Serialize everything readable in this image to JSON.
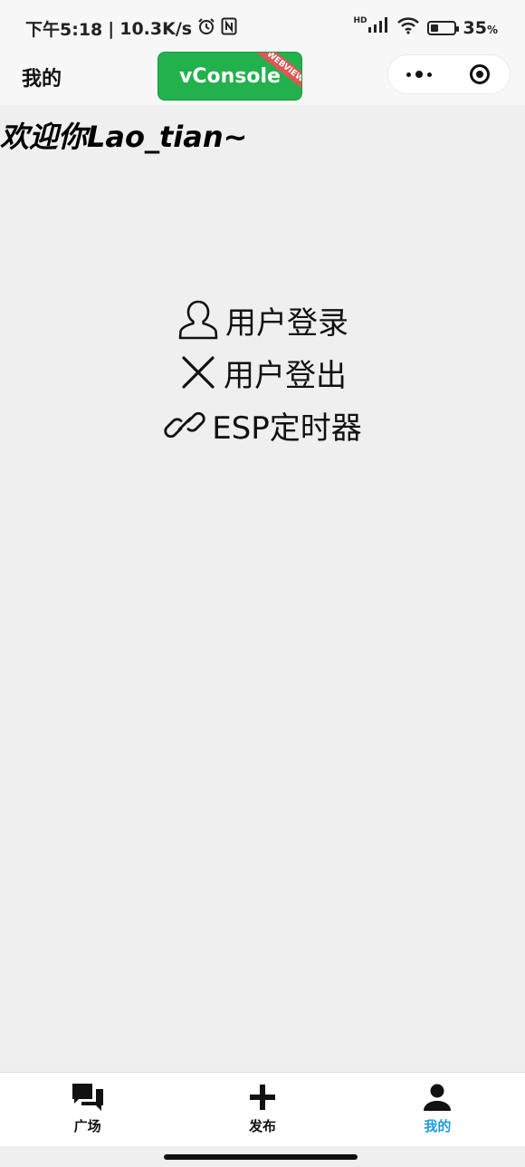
{
  "status_bar": {
    "time": "下午5:18",
    "network_speed": "10.3K/s",
    "signal_label": "HD",
    "battery_percent": "35",
    "battery_unit": "%",
    "battery_level": 0.35,
    "icons": [
      "alarm-icon",
      "nfc-icon",
      "signal-icon",
      "wifi-icon",
      "battery-icon"
    ]
  },
  "nav_bar": {
    "title": "我的",
    "vconsole_label": "vConsole",
    "vconsole_ribbon": "WEBVIEW",
    "vconsole_color": "#23b14d"
  },
  "main": {
    "welcome": "欢迎你Lao_tian~",
    "menu": [
      {
        "icon": "user-icon",
        "label": "用户登录"
      },
      {
        "icon": "close-icon",
        "label": "用户登出"
      },
      {
        "icon": "link-icon",
        "label": "ESP定时器"
      }
    ]
  },
  "tab_bar": {
    "active_color": "#1e9be0",
    "tabs": [
      {
        "icon": "chat-icon",
        "label": "广场"
      },
      {
        "icon": "plus-icon",
        "label": "发布"
      },
      {
        "icon": "person-icon",
        "label": "我的",
        "active": true
      }
    ]
  }
}
